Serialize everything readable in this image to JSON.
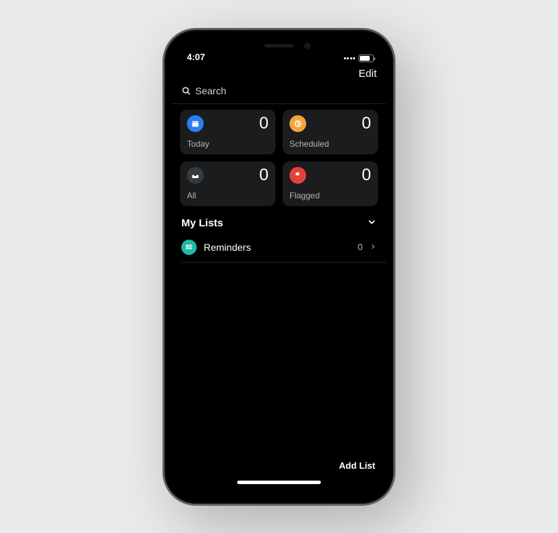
{
  "status": {
    "time": "4:07",
    "battery_pct": 70
  },
  "nav": {
    "edit_label": "Edit"
  },
  "search": {
    "placeholder": "Search"
  },
  "tiles": {
    "today": {
      "label": "Today",
      "count": "0",
      "color": "#2a7ff0"
    },
    "scheduled": {
      "label": "Scheduled",
      "count": "0",
      "color": "#f3a53d"
    },
    "all": {
      "label": "All",
      "count": "0",
      "color": "#353a40"
    },
    "flagged": {
      "label": "Flagged",
      "count": "0",
      "color": "#e5413b"
    }
  },
  "section": {
    "title": "My Lists"
  },
  "lists": [
    {
      "name": "Reminders",
      "count": "0",
      "color": "#1fb8a8"
    }
  ],
  "footer": {
    "add_list_label": "Add List"
  }
}
